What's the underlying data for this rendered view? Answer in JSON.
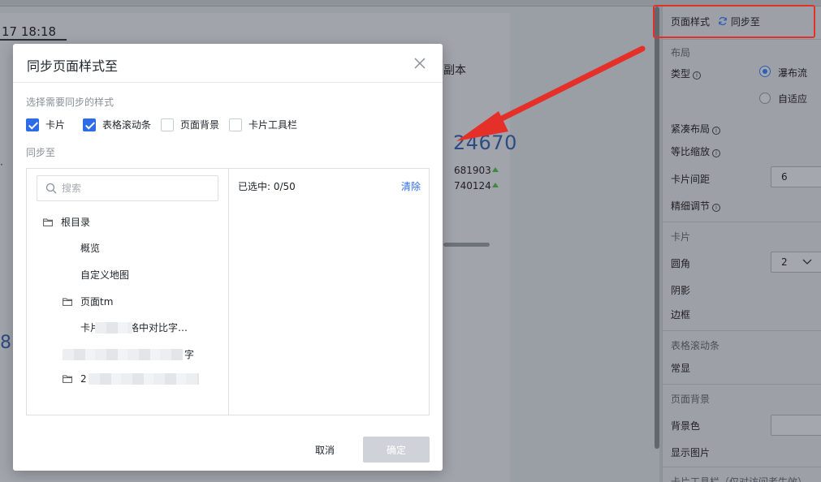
{
  "background": {
    "timestamp": "17 18:18",
    "copy_label": "副本",
    "big_number": "24670",
    "metric_1": "681903",
    "metric_2": "740124",
    "left_number": "8"
  },
  "settings_panel": {
    "page_style_label": "页面样式",
    "sync_link": "同步至",
    "layout_section": "布局",
    "type_label": "类型",
    "type_options": [
      "瀑布流",
      "自适应"
    ],
    "type_selected": "瀑布流",
    "compact_layout": "紧凑布局",
    "proportional_zoom": "等比缩放",
    "card_spacing_label": "卡片间距",
    "card_spacing_value": "6",
    "fine_tune": "精细调节",
    "card_section": "卡片",
    "corner_label": "圆角",
    "corner_value": "2",
    "shadow_label": "阴影",
    "border_label": "边框",
    "table_scrollbar_section": "表格滚动条",
    "always_show": "常显",
    "page_bg_section": "页面背景",
    "bg_color_label": "背景色",
    "show_image_label": "显示图片",
    "card_toolbar_cut": "卡片工具栏（仅对访问者生效）"
  },
  "dialog": {
    "title": "同步页面样式至",
    "select_styles_label": "选择需要同步的样式",
    "style_options": [
      {
        "label": "卡片",
        "checked": true
      },
      {
        "label": "表格滚动条",
        "checked": true
      },
      {
        "label": "页面背景",
        "checked": false
      },
      {
        "label": "卡片工具栏",
        "checked": false
      }
    ],
    "sync_to_label": "同步至",
    "search_placeholder": "搜索",
    "tree": {
      "root": "根目录",
      "item_overview": "概览",
      "item_custom_map": "自定义地图",
      "folder_page_tm": "页面tm",
      "item_card_compare": "卡片设置表格中对比字…",
      "item_blurred_suffix": "字",
      "folder_2_prefix": "2"
    },
    "selected_count": "已选中: 0/50",
    "clear_label": "清除",
    "cancel_label": "取消",
    "ok_label": "确定"
  },
  "colors": {
    "accent": "#2e6be6",
    "annotation_red": "#e5302a"
  }
}
